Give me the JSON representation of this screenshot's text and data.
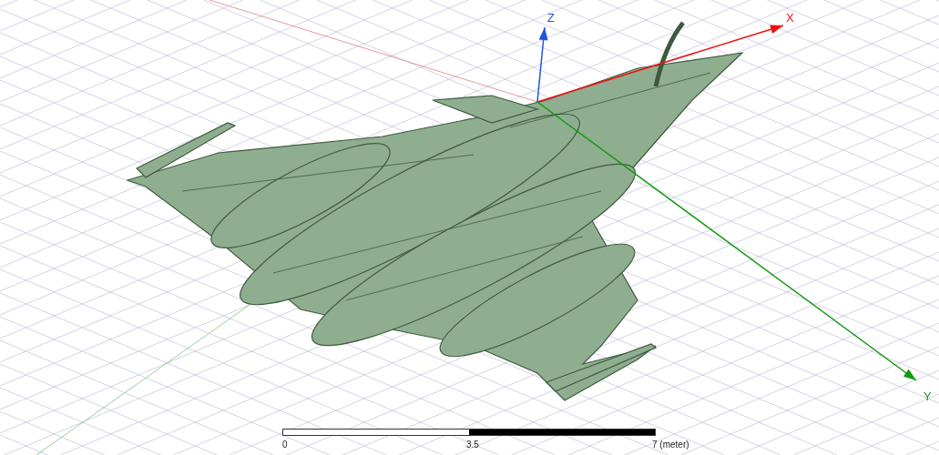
{
  "viewport": {
    "axes": [
      {
        "kind": "z",
        "label": "Z",
        "color": "#2255dd"
      },
      {
        "kind": "x",
        "label": "X",
        "color": "#ee1111"
      },
      {
        "kind": "y",
        "label": "Y",
        "color": "#119911"
      }
    ]
  },
  "scale_bar": {
    "labels": [
      "0",
      "3.5",
      "7 (meter)"
    ]
  }
}
